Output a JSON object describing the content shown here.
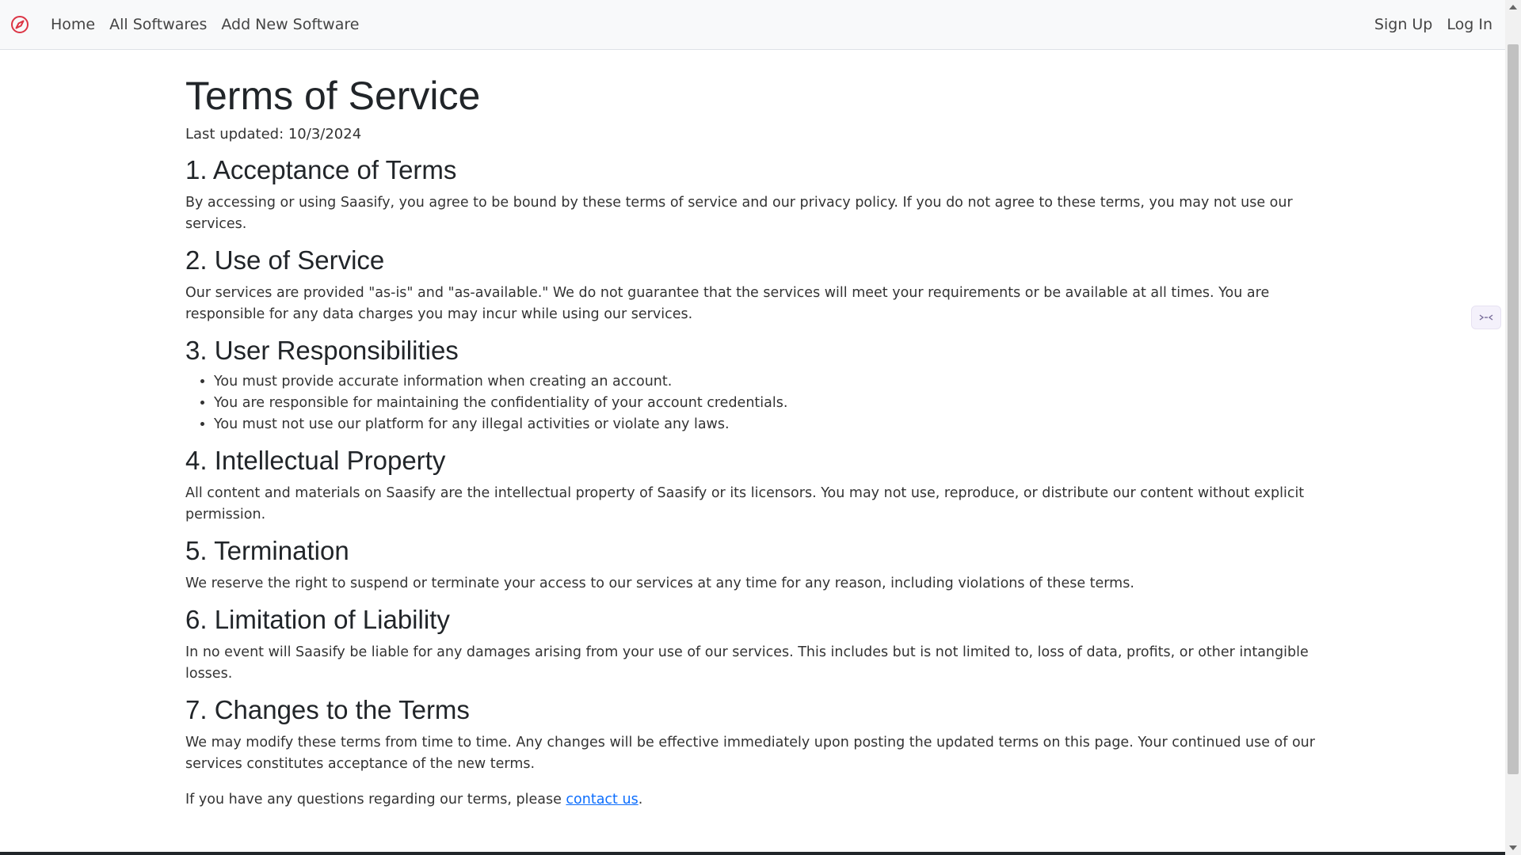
{
  "nav": {
    "brand_icon": "compass-icon",
    "brand_color": "#dc3545",
    "links": [
      "Home",
      "All Softwares",
      "Add New Software"
    ],
    "right_links": [
      "Sign Up",
      "Log In"
    ]
  },
  "page": {
    "title": "Terms of Service",
    "last_updated": "Last updated: 10/3/2024",
    "sections": [
      {
        "heading": "1. Acceptance of Terms",
        "text": "By accessing or using Saasify, you agree to be bound by these terms of service and our privacy policy. If you do not agree to these terms, you may not use our services."
      },
      {
        "heading": "2. Use of Service",
        "text": "Our services are provided \"as-is\" and \"as-available.\" We do not guarantee that the services will meet your requirements or be available at all times. You are responsible for any data charges you may incur while using our services."
      },
      {
        "heading": "3. User Responsibilities",
        "items": [
          "You must provide accurate information when creating an account.",
          "You are responsible for maintaining the confidentiality of your account credentials.",
          "You must not use our platform for any illegal activities or violate any laws."
        ]
      },
      {
        "heading": "4. Intellectual Property",
        "text": "All content and materials on Saasify are the intellectual property of Saasify or its licensors. You may not use, reproduce, or distribute our content without explicit permission."
      },
      {
        "heading": "5. Termination",
        "text": "We reserve the right to suspend or terminate your access to our services at any time for any reason, including violations of these terms."
      },
      {
        "heading": "6. Limitation of Liability",
        "text": "In no event will Saasify be liable for any damages arising from your use of our services. This includes but is not limited to, loss of data, profits, or other intangible losses."
      },
      {
        "heading": "7. Changes to the Terms",
        "text": "We may modify these terms from time to time. Any changes will be effective immediately upon posting the updated terms on this page. Your continued use of our services constitutes acceptance of the new terms."
      }
    ],
    "contact": {
      "prefix": "If you have any questions regarding our terms, please ",
      "link_text": "contact us",
      "suffix": "."
    }
  },
  "widget": {
    "icon": "code-widget-icon"
  },
  "colors": {
    "link": "#0d6efd",
    "navbar_bg": "#f8f9fa"
  }
}
